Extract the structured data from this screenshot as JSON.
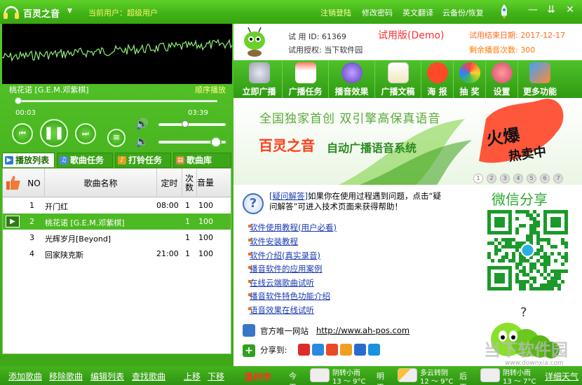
{
  "app": {
    "title": "百灵之音",
    "current_user": "当前用户：超级用户",
    "menu": [
      "注销登陆",
      "修改密码",
      "英文翻译",
      "云备份/恢复"
    ]
  },
  "player": {
    "song_title": "桃花诺 [G.E.M.邓紫棋]",
    "play_mode": "顺序播放",
    "time_current": "00:03",
    "time_total": "03:39",
    "progress": 0.014,
    "volume": 0.4,
    "tts_volume": 0.85
  },
  "tabs": [
    "播放列表",
    "歌曲任务",
    "打铃任务",
    "歌曲库"
  ],
  "song_table": {
    "headers": [
      "NO",
      "歌曲名称",
      "定时",
      "次数",
      "音量"
    ],
    "rows": [
      {
        "no": "1",
        "name": "开门红",
        "time": "08:00",
        "count": "1",
        "vol": "100"
      },
      {
        "no": "2",
        "name": "桃花诺 [G.E.M.邓紫棋]",
        "time": "",
        "count": "1",
        "vol": "100"
      },
      {
        "no": "3",
        "name": "光辉岁月[Beyond]",
        "time": "",
        "count": "1",
        "vol": "100"
      },
      {
        "no": "4",
        "name": "回家陕克斯",
        "time": "21:00",
        "count": "1",
        "vol": "100"
      }
    ]
  },
  "bottom_links": [
    "添加歌曲",
    "移除歌曲",
    "编辑列表",
    "查找歌曲",
    "上移",
    "下移"
  ],
  "weather": {
    "city": "温州市",
    "days": [
      {
        "day": "今天",
        "cond": "阴转小雨",
        "temp": "13 ～ 9°C"
      },
      {
        "day": "明天",
        "cond": "多云转阴",
        "temp": "12 ～ 9°C"
      },
      {
        "day": "后天",
        "cond": "阴转小雨",
        "temp": "13 ～ 7°C"
      }
    ],
    "detail": "详细天气"
  },
  "trial": {
    "id": "试 用 ID: 61369",
    "auth": "试用授权: 当下软件园",
    "title": "试用版(Demo)",
    "end_date": "试用结束日期: 2017-12-17",
    "remaining": "剩余播音次数: 300"
  },
  "toolbar": [
    "立即广播",
    "广播任务",
    "播音效果",
    "广播文稿",
    "海 报",
    "抽 奖",
    "设置",
    "更多功能"
  ],
  "banner": {
    "line1": "全国独家首创  双引擎高保真语音",
    "brand": "百灵之音",
    "sub": "自动广播语音系统",
    "hot": "火爆",
    "hot2": "热卖中",
    "dots": [
      "1",
      "2",
      "3",
      "4",
      "5",
      "6",
      "7"
    ]
  },
  "faq": {
    "link": "[疑问解答]",
    "text": "如果你在使用过程遇到问题，点击“疑问解答”可进入技术页面来获得帮助！"
  },
  "links": [
    "软件使用教程(用户必看)",
    "软件安装教程",
    "软件介绍(真实录音)",
    "播音软件的应用案例",
    "在线云端歌曲试听",
    "播音软件特色功能介绍",
    "语音效果在线试听"
  ],
  "site": {
    "label": "官方唯一网站",
    "url": "http://www.ah-pos.com"
  },
  "share": {
    "label": "分享到:"
  },
  "wechat": {
    "title": "微信分享"
  },
  "watermark": {
    "text": "当下软件园",
    "url": "www.downxia.com"
  },
  "colors": {
    "brand_green": "#3fb116",
    "accent_red": "#ff3030",
    "link_blue": "#1a3ab0"
  }
}
